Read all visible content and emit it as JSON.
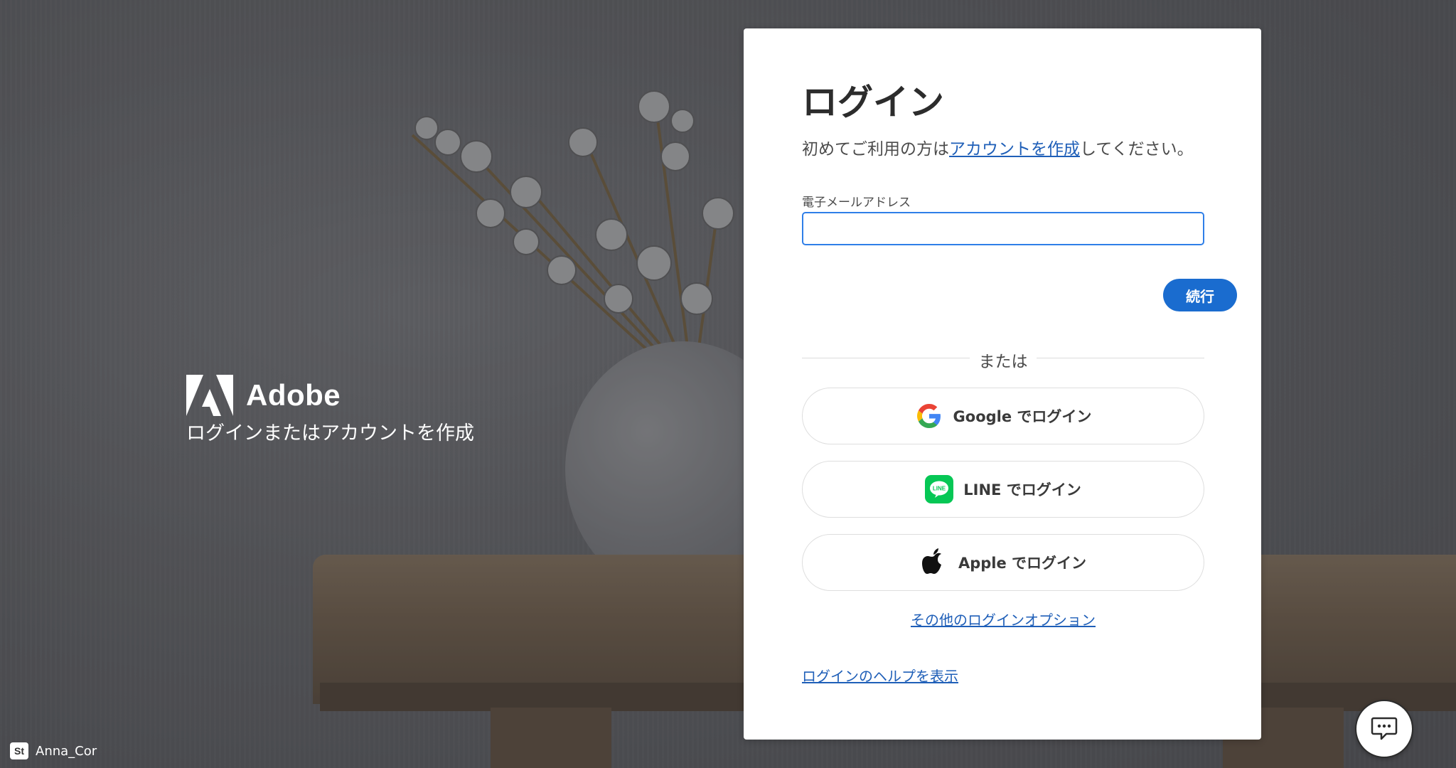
{
  "brand": {
    "name": "Adobe",
    "tagline": "ログインまたはアカウントを作成"
  },
  "photo_credit": {
    "badge": "St",
    "author": "Anna_Cor"
  },
  "login": {
    "title": "ログイン",
    "subtitle_prefix": "初めてご利用の方は",
    "create_account_link": "アカウントを作成",
    "subtitle_suffix": "してください。",
    "email_label": "電子メールアドレス",
    "email_value": "",
    "continue_label": "続行",
    "divider_text": "または",
    "google_label": "Google でログイン",
    "line_label": "LINE でログイン",
    "apple_label": "Apple でログイン",
    "more_options_link": "その他のログインオプション",
    "help_link": "ログインのヘルプを表示"
  },
  "icons": {
    "google": "google-icon",
    "line": "line-icon",
    "apple": "apple-icon",
    "chat": "chat-icon",
    "adobe": "adobe-logo"
  },
  "colors": {
    "accent": "#1a6ccf",
    "link": "#1f5fb8",
    "input_focus": "#2f7fe8",
    "line_green": "#06c755"
  }
}
